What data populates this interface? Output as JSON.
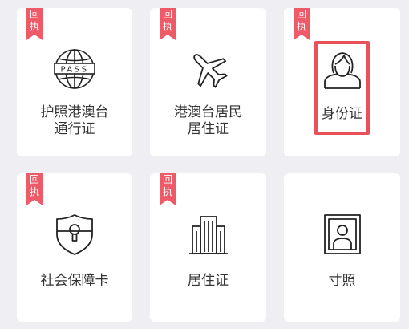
{
  "colors": {
    "background": "#eeeef3",
    "card": "#ffffff",
    "ribbon": "#ee5a68",
    "highlight": "#e8505b",
    "text": "#333333"
  },
  "badge_text": "回执",
  "cards": [
    {
      "id": "passport-hk-macau-tw",
      "label_lines": [
        "护照港澳台",
        "通行证"
      ],
      "icon": "passport-globe-icon",
      "has_badge": true
    },
    {
      "id": "hk-macau-tw-residence",
      "label_lines": [
        "港澳台居民",
        "居住证"
      ],
      "icon": "airplane-icon",
      "has_badge": true
    },
    {
      "id": "id-card",
      "label_lines": [
        "身份证"
      ],
      "icon": "person-portrait-icon",
      "has_badge": true,
      "selected": true
    },
    {
      "id": "social-security-card",
      "label_lines": [
        "社会保障卡"
      ],
      "icon": "shield-keyhole-icon",
      "has_badge": true
    },
    {
      "id": "residence-permit",
      "label_lines": [
        "居住证"
      ],
      "icon": "building-icon",
      "has_badge": true
    },
    {
      "id": "inch-photo",
      "label_lines": [
        "寸照"
      ],
      "icon": "framed-portrait-icon",
      "has_badge": false
    }
  ]
}
